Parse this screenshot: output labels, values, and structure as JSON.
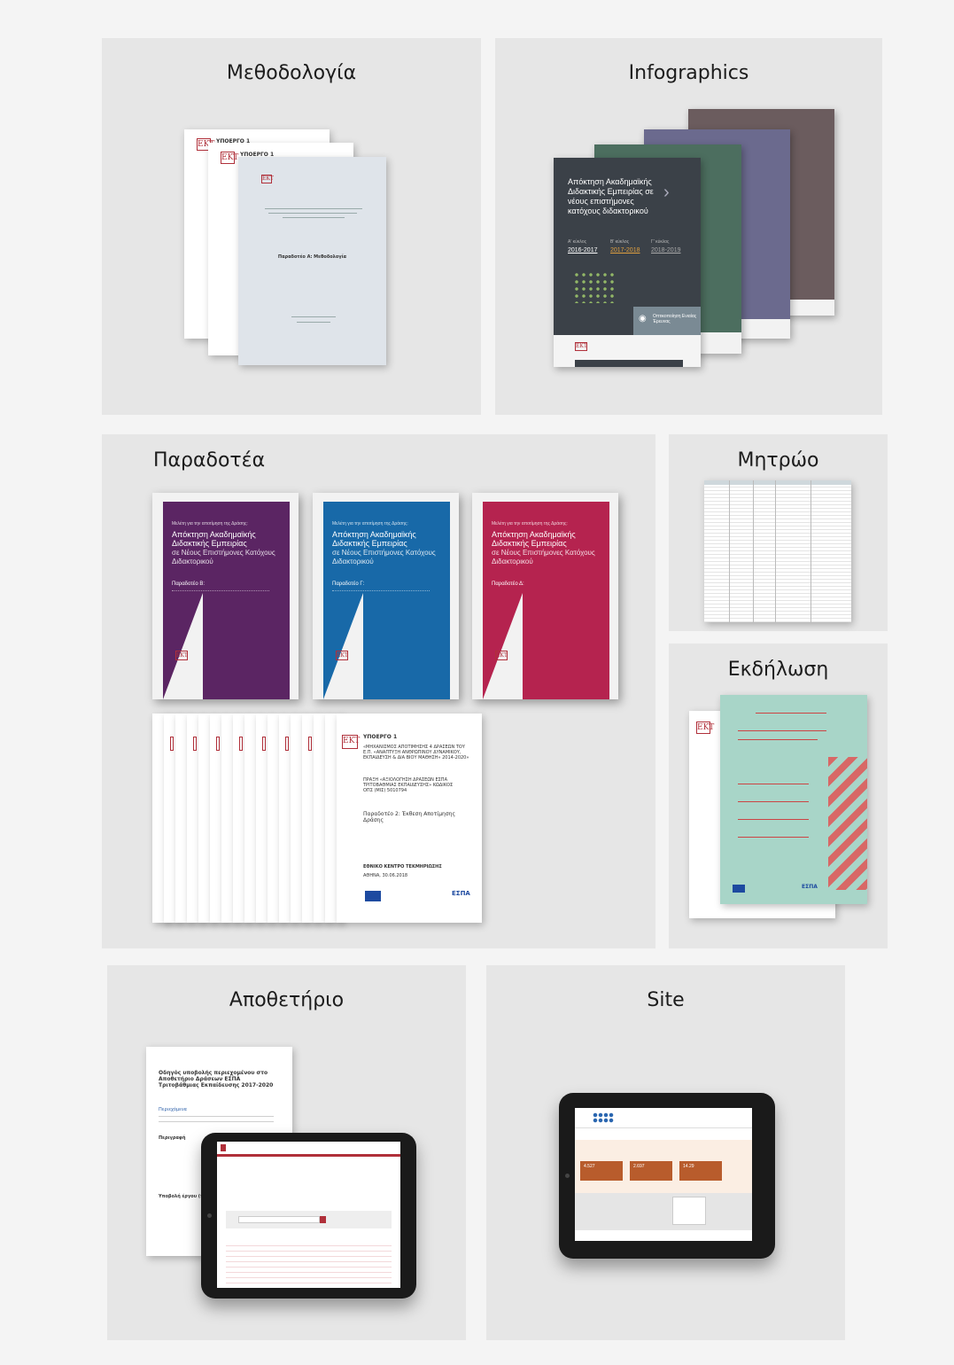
{
  "panels": {
    "methodology": "Μεθοδολογία",
    "infographics": "Infographics",
    "deliverables": "Παραδοτέα",
    "registry": "Μητρώο",
    "event": "Εκδήλωση",
    "repository": "Αποθετήριο",
    "site": "Site"
  },
  "methodology_docs": {
    "sub1": "ΥΠΟΕΡΓΟ 1",
    "sub1b": "ΥΠΟΕΡΓΟ 1",
    "deliverable": "Παραδοτέο Α: Μεθοδολογία"
  },
  "infographic": {
    "title": "Απόκτηση Ακαδημαϊκής Διδακτικής Εμπειρίας σε νέους επιστήμονες κατόχους διδακτορικού",
    "cycles": [
      "Α' κύκλος",
      "Β' κύκλος",
      "Γ' κύκλος"
    ],
    "years": [
      "2016-2017",
      "2017-2018",
      "2018-2019"
    ],
    "badge": "Οπτικοποίηση Ενιαίας Έρευνας",
    "colors": [
      "#3b4148",
      "#4c6e5f",
      "#6b6a8e",
      "#6b5c5e"
    ]
  },
  "deliverable_covers": [
    {
      "color": "#5b2563",
      "series": "Μελέτη για την αποτίμηση της Δράσης:",
      "title": "Απόκτηση Ακαδημαϊκής Διδακτικής Εμπειρίας",
      "subtitle": "σε Νέους Επιστήμονες Κατόχους Διδακτορικού",
      "label": "Παραδοτέο Β:"
    },
    {
      "color": "#1869a8",
      "series": "Μελέτη για την αποτίμηση της Δράσης:",
      "title": "Απόκτηση Ακαδημαϊκής Διδακτικής Εμπειρίας",
      "subtitle": "σε Νέους Επιστήμονες Κατόχους Διδακτορικού",
      "label": "Παραδοτέο Γ:"
    },
    {
      "color": "#b5234f",
      "series": "Μελέτη για την αποτίμηση της Δράσης:",
      "title": "Απόκτηση Ακαδημαϊκής Διδακτικής Εμπειρίας",
      "subtitle": "σε Νέους Επιστήμονες Κατόχους Διδακτορικού",
      "label": "Παραδοτέο Δ:"
    }
  ],
  "report": {
    "sub": "ΥΠΟΕΡΓΟ 1",
    "mechanism": "«ΜΗΧΑΝΙΣΜΟΣ ΑΠΟΤΙΜΗΣΗΣ 4 ΔΡΑΣΕΩΝ ΤΟΥ Ε.Π. «ΑΝΑΠΤΥΞΗ ΑΝΘΡΩΠΙΝΟΥ ΔΥΝΑΜΙΚΟΥ, ΕΚΠΑΙΔΕΥΣΗ & ΔΙΑ ΒΙΟΥ ΜΑΘΗΣΗ» 2014-2020»",
    "action": "ΠΡΑΞΗ «ΑΞΙΟΛΟΓΗΣΗ ΔΡΑΣΕΩΝ ΕΣΠΑ ΤΡΙΤΟΒΑΘΜΙΑΣ ΕΚΠΑΙΔΕΥΣΗΣ» ΚΩΔΙΚΟΣ ΟΠΣ (ΜΙΣ) 5010794",
    "deliverable": "Παραδοτέο 2: Έκθεση Αποτίμησης Δράσης",
    "center": "ΕΘΝΙΚΟ ΚΕΝΤΡΟ ΤΕΚΜΗΡΙΩΣΗΣ",
    "place": "ΑΘΗΝΑ, 30.06.2018",
    "espa": "ΕΣΠΑ"
  },
  "repository_doc": {
    "title": "Οδηγός υποβολής περιεχομένου στο Αποθετήριο Δράσεων ΕΣΠΑ Τριτοβάθμιας Εκπαίδευσης 2017-2020",
    "toc": "Περιεχόμενα",
    "intro": "Περιγραφή",
    "section": "Υποβολή έργου (πεδ"
  },
  "site": {
    "stats": [
      "4.527",
      "2.697",
      "14.29"
    ]
  },
  "brand": {
    "ekt": "ΕΚΤ"
  }
}
